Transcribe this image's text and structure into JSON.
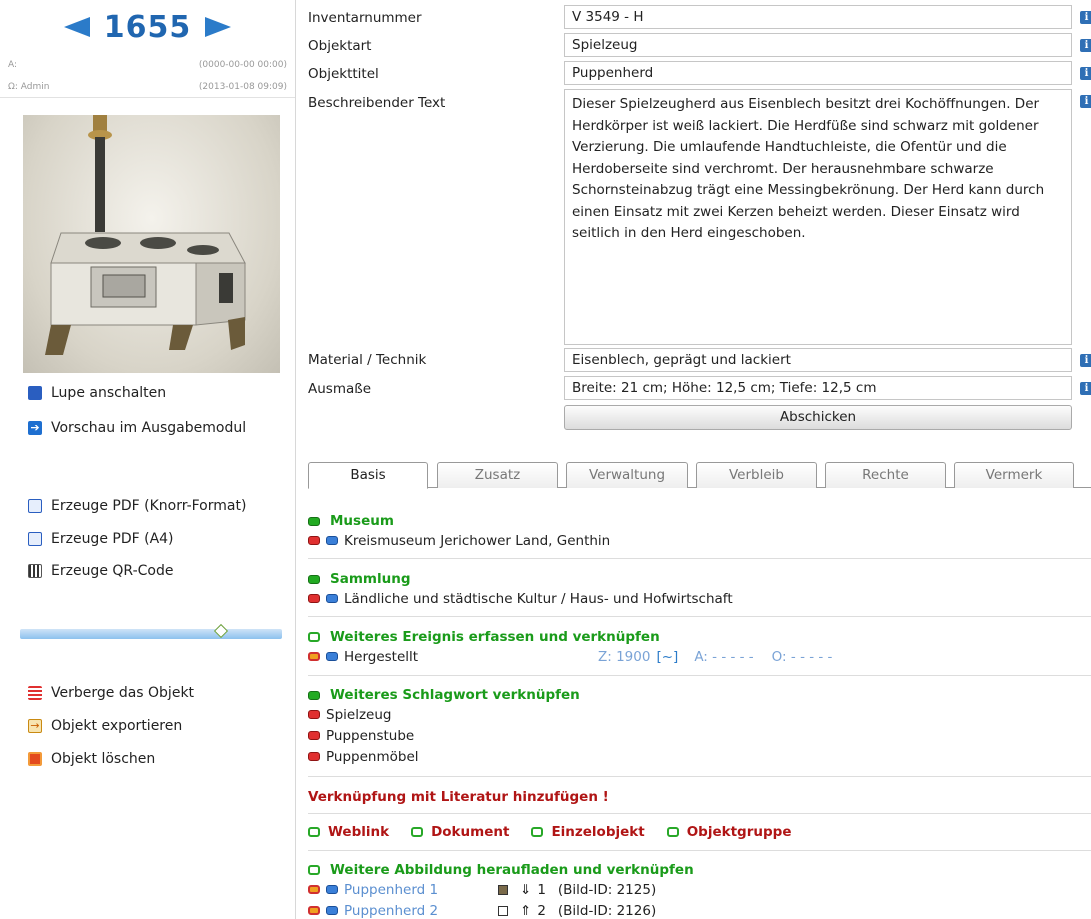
{
  "nav": {
    "object_number": "1655"
  },
  "meta": {
    "created_label": "A:",
    "created_value": "(0000-00-00 00:00)",
    "modified_label": "Ω:  Admin",
    "modified_value": "(2013-01-08 09:09)"
  },
  "actions": {
    "magnifier": "Lupe anschalten",
    "preview": "Vorschau im Ausgabemodul",
    "pdf_knorr": "Erzeuge PDF (Knorr-Format)",
    "pdf_a4": "Erzeuge PDF (A4)",
    "qr": "Erzeuge QR-Code",
    "hide": "Verberge das Objekt",
    "export": "Objekt exportieren",
    "delete": "Objekt löschen"
  },
  "form": {
    "inventory_label": "Inventarnummer",
    "inventory_value": "V 3549 - H",
    "type_label": "Objektart",
    "type_value": "Spielzeug",
    "title_label": "Objekttitel",
    "title_value": "Puppenherd",
    "desc_label": "Beschreibender Text",
    "desc_value": "Dieser Spielzeugherd aus Eisenblech besitzt drei Kochöffnungen. Der Herdkörper ist weiß lackiert. Die Herdfüße sind schwarz mit goldener Verzierung. Die umlaufende Handtuchleiste, die Ofentür und die Herdoberseite sind verchromt. Der herausnehmbare schwarze Schornsteinabzug trägt eine Messingbekrönung. Der Herd kann durch einen Einsatz mit zwei Kerzen beheizt werden. Dieser Einsatz wird seitlich in den Herd eingeschoben.",
    "material_label": "Material / Technik",
    "material_value": "Eisenblech, geprägt und lackiert",
    "dimensions_label": "Ausmaße",
    "dimensions_value": "Breite: 21 cm; Höhe: 12,5 cm; Tiefe: 12,5 cm",
    "submit_label": "Abschicken",
    "info_glyph": "i"
  },
  "tabs": [
    "Basis",
    "Zusatz",
    "Verwaltung",
    "Verbleib",
    "Rechte",
    "Vermerk"
  ],
  "active_tab": "Basis",
  "slider_level": 0.75,
  "sections": {
    "museum_head": "Museum",
    "museum_item": "Kreismuseum Jerichower Land, Genthin",
    "collection_head": "Sammlung",
    "collection_item": "Ländliche und städtische Kultur / Haus- und Hofwirtschaft",
    "event_head": "Weiteres Ereignis erfassen und verknüpfen",
    "event_item": "Hergestellt",
    "event_z": "Z: 1900",
    "event_tilde": "[~]",
    "event_a": "A: - - - - -",
    "event_o": "O: - - - - -",
    "keyword_head": "Weiteres Schlagwort verknüpfen",
    "keywords": [
      "Spielzeug",
      "Puppenstube",
      "Puppenmöbel"
    ],
    "literature": "Verknüpfung mit Literatur hinzufügen !",
    "links": [
      "Weblink",
      "Dokument",
      "Einzelobjekt",
      "Objektgruppe"
    ],
    "image_head": "Weitere Abbildung heraufladen und verknüpfen",
    "images": [
      {
        "name": "Puppenherd 1",
        "arrow": "⇓",
        "index": "1",
        "id": "(Bild-ID: 2125)"
      },
      {
        "name": "Puppenherd 2",
        "arrow": "⇑",
        "index": "2",
        "id": "(Bild-ID: 2126)"
      }
    ]
  },
  "colors": {
    "accent": "#2b7bc9",
    "green": "#1a9b1a",
    "red": "#b01515"
  }
}
